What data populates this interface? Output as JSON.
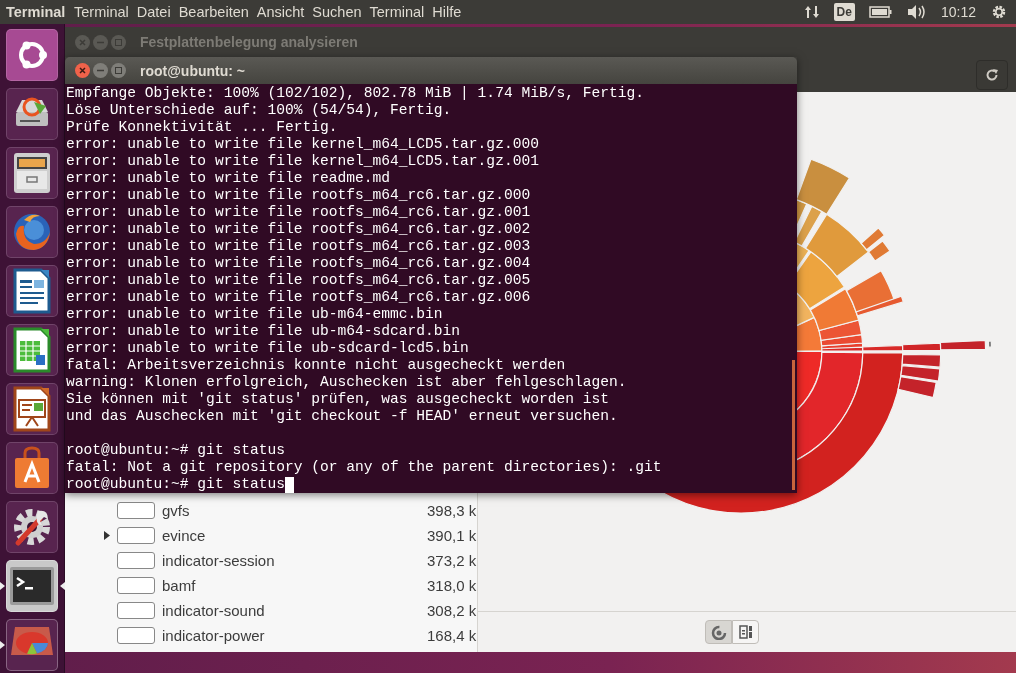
{
  "top_panel": {
    "app_name": "Terminal",
    "menu": [
      "Terminal",
      "Datei",
      "Bearbeiten",
      "Ansicht",
      "Suchen",
      "Terminal",
      "Hilfe"
    ],
    "keyboard_layout": "De",
    "clock": "10:12"
  },
  "launcher": {
    "items": [
      {
        "kind": "dash",
        "running": false,
        "focused": false
      },
      {
        "kind": "installer",
        "running": false,
        "focused": false
      },
      {
        "kind": "files",
        "running": false,
        "focused": false
      },
      {
        "kind": "browser",
        "running": false,
        "focused": false
      },
      {
        "kind": "writer",
        "running": false,
        "focused": false
      },
      {
        "kind": "calc",
        "running": false,
        "focused": false
      },
      {
        "kind": "impress",
        "running": false,
        "focused": false
      },
      {
        "kind": "software",
        "running": false,
        "focused": false
      },
      {
        "kind": "settings",
        "running": false,
        "focused": false
      },
      {
        "kind": "terminal",
        "running": true,
        "focused": true
      },
      {
        "kind": "disk_usage",
        "running": true,
        "focused": false
      }
    ]
  },
  "disk_usage_window": {
    "title": "Festplattenbelegung analysieren",
    "rows": [
      {
        "name": "gvfs",
        "size": "398,3 k",
        "expandable": false
      },
      {
        "name": "evince",
        "size": "390,1 k",
        "expandable": true
      },
      {
        "name": "indicator-session",
        "size": "373,2 k",
        "expandable": false
      },
      {
        "name": "bamf",
        "size": "318,0 k",
        "expandable": false
      },
      {
        "name": "indicator-sound",
        "size": "308,2 k",
        "expandable": false
      },
      {
        "name": "indicator-power",
        "size": "168,4 k",
        "expandable": false
      }
    ],
    "view_toggle": [
      {
        "kind": "rings",
        "selected": true
      },
      {
        "kind": "treemap",
        "selected": false
      }
    ]
  },
  "terminal_window": {
    "title": "root@ubuntu: ~",
    "lines": [
      {
        "kind": "text",
        "text": "Empfange Objekte: 100% (102/102), 802.78 MiB | 1.74 MiB/s, Fertig.",
        "cursor": false
      },
      {
        "kind": "text",
        "text": "Löse Unterschiede auf: 100% (54/54), Fertig.",
        "cursor": false
      },
      {
        "kind": "text",
        "text": "Prüfe Konnektivität ... Fertig.",
        "cursor": false
      },
      {
        "kind": "text",
        "text": "error: unable to write file kernel_m64_LCD5.tar.gz.000",
        "cursor": false
      },
      {
        "kind": "text",
        "text": "error: unable to write file kernel_m64_LCD5.tar.gz.001",
        "cursor": false
      },
      {
        "kind": "text",
        "text": "error: unable to write file readme.md",
        "cursor": false
      },
      {
        "kind": "text",
        "text": "error: unable to write file rootfs_m64_rc6.tar.gz.000",
        "cursor": false
      },
      {
        "kind": "text",
        "text": "error: unable to write file rootfs_m64_rc6.tar.gz.001",
        "cursor": false
      },
      {
        "kind": "text",
        "text": "error: unable to write file rootfs_m64_rc6.tar.gz.002",
        "cursor": false
      },
      {
        "kind": "text",
        "text": "error: unable to write file rootfs_m64_rc6.tar.gz.003",
        "cursor": false
      },
      {
        "kind": "text",
        "text": "error: unable to write file rootfs_m64_rc6.tar.gz.004",
        "cursor": false
      },
      {
        "kind": "text",
        "text": "error: unable to write file rootfs_m64_rc6.tar.gz.005",
        "cursor": false
      },
      {
        "kind": "text",
        "text": "error: unable to write file rootfs_m64_rc6.tar.gz.006",
        "cursor": false
      },
      {
        "kind": "text",
        "text": "error: unable to write file ub-m64-emmc.bin",
        "cursor": false
      },
      {
        "kind": "text",
        "text": "error: unable to write file ub-m64-sdcard.bin",
        "cursor": false
      },
      {
        "kind": "text",
        "text": "error: unable to write file ub-sdcard-lcd5.bin",
        "cursor": false
      },
      {
        "kind": "text",
        "text": "fatal: Arbeitsverzeichnis konnte nicht ausgecheckt werden",
        "cursor": false
      },
      {
        "kind": "text",
        "text": "warning: Klonen erfolgreich, Auschecken ist aber fehlgeschlagen.",
        "cursor": false
      },
      {
        "kind": "text",
        "text": "Sie können mit 'git status' prüfen, was ausgecheckt worden ist",
        "cursor": false
      },
      {
        "kind": "text",
        "text": "und das Auschecken mit 'git checkout -f HEAD' erneut versuchen.",
        "cursor": false
      },
      {
        "kind": "blank",
        "cursor": false
      },
      {
        "kind": "text",
        "text": "root@ubuntu:~# git status",
        "cursor": false
      },
      {
        "kind": "text",
        "text": "fatal: Not a git repository (or any of the parent directories): .git",
        "cursor": false
      },
      {
        "kind": "text",
        "text": "root@ubuntu:~# git status",
        "cursor": true
      }
    ]
  }
}
